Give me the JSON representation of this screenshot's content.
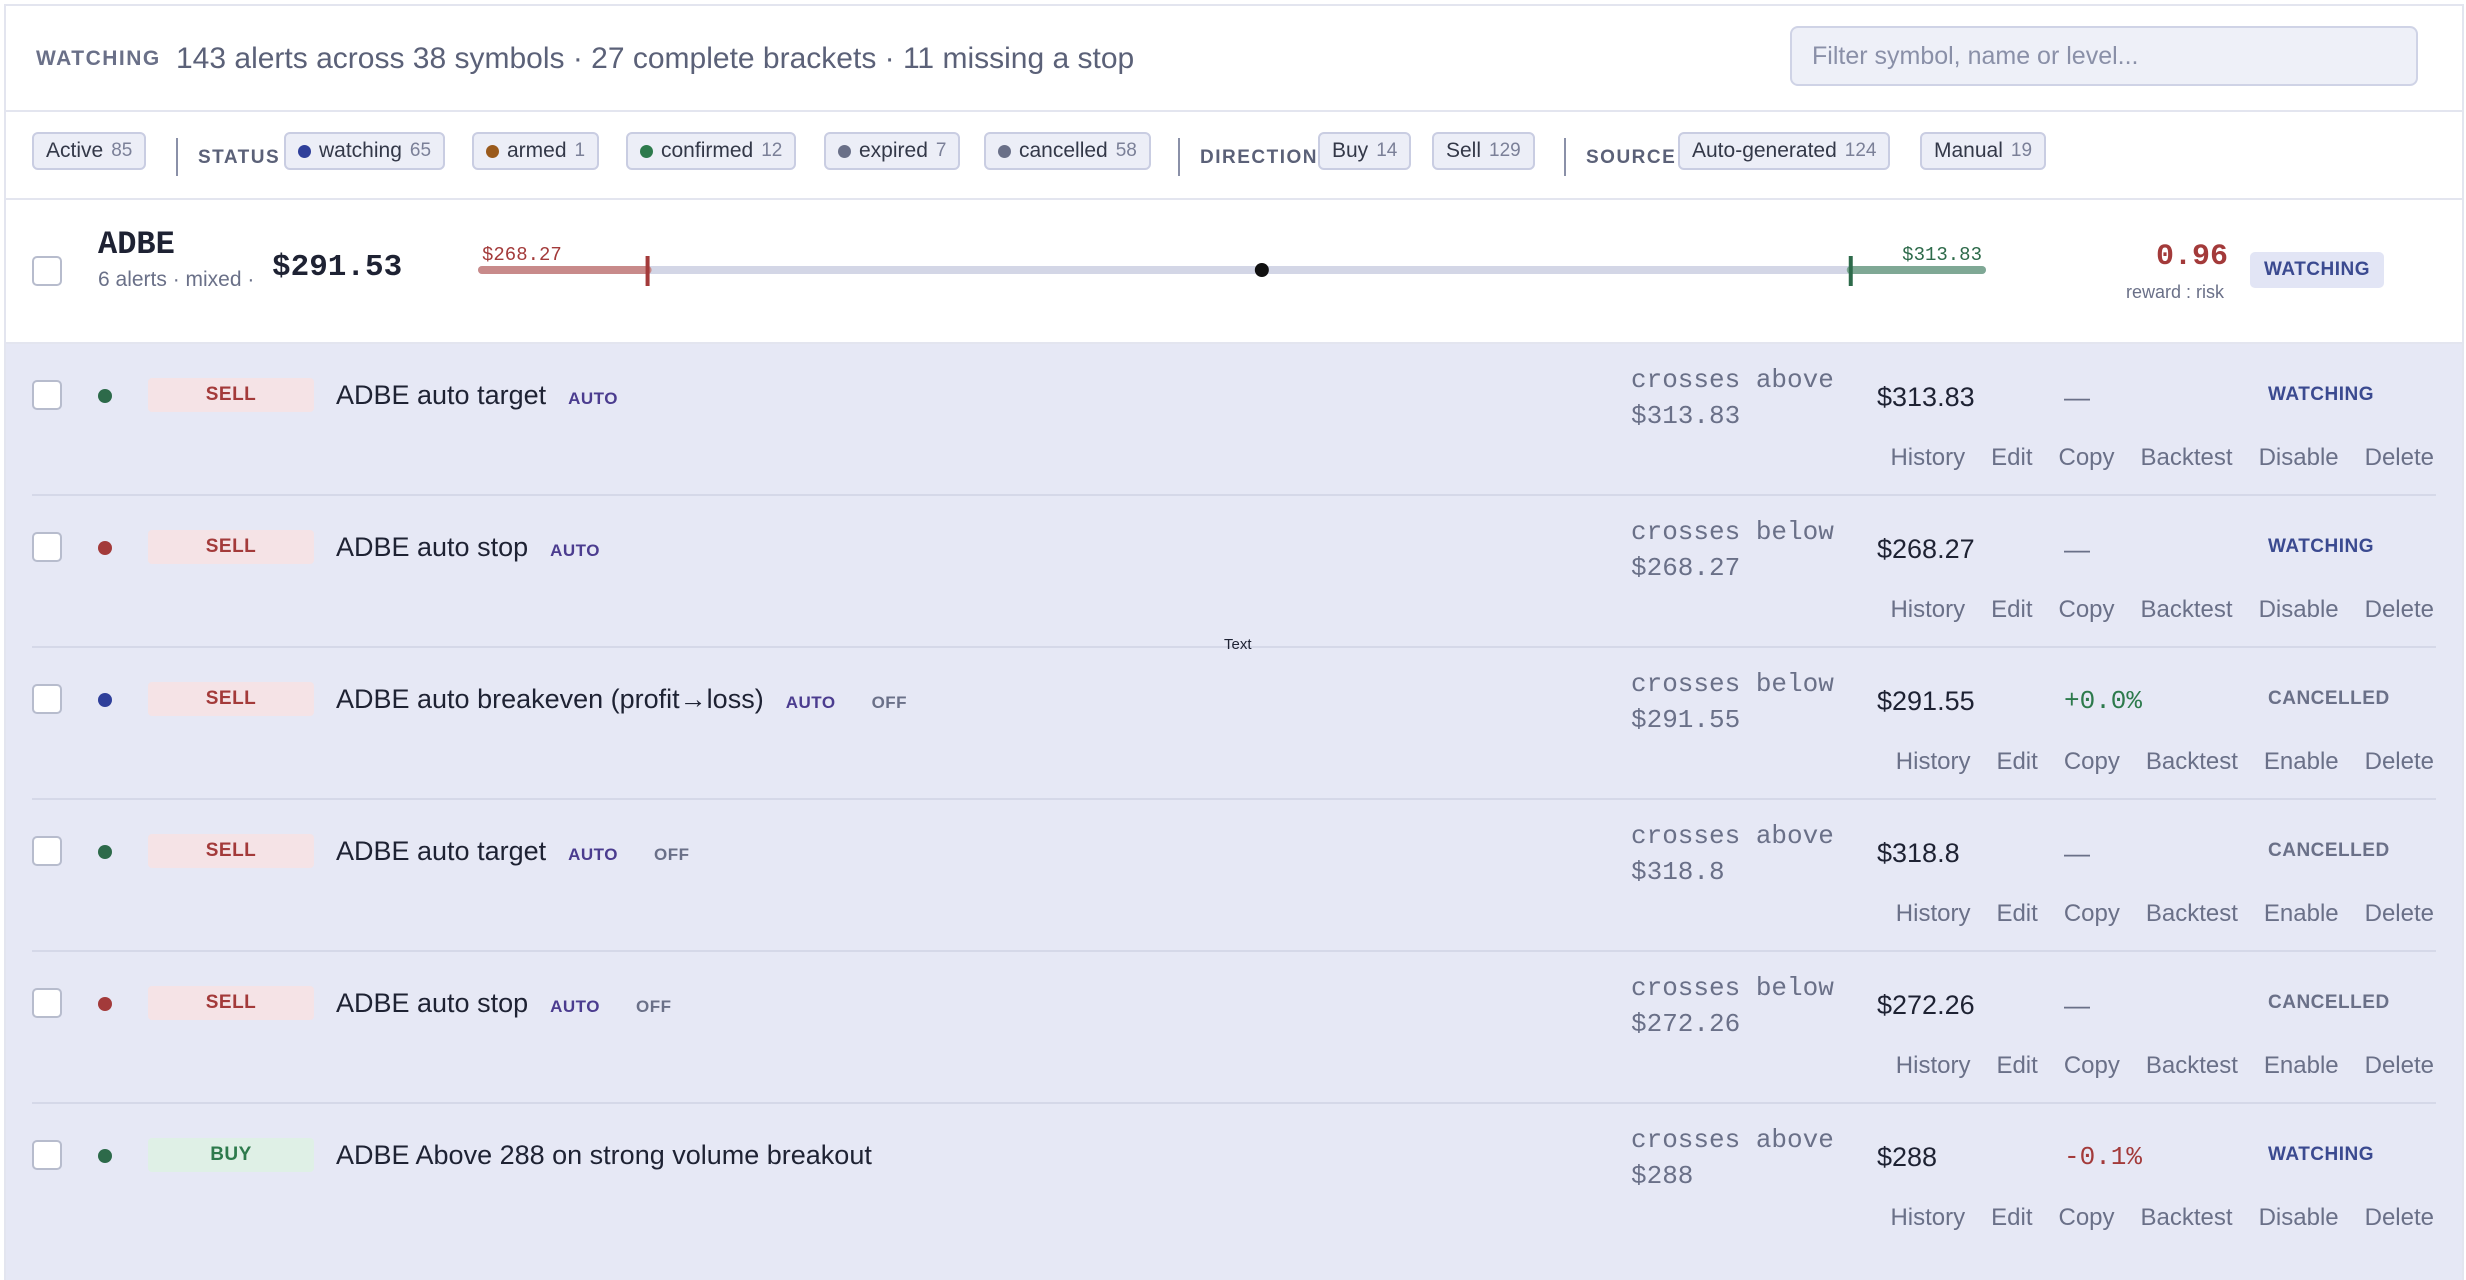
{
  "header": {
    "kicker": "WATCHING",
    "summary": "143 alerts across 38 symbols · 27 complete brackets · 11 missing a stop",
    "search_placeholder": "Filter symbol, name or level..."
  },
  "filters": {
    "active": {
      "label": "Active",
      "count": "85"
    },
    "status_label": "STATUS",
    "status": [
      {
        "label": "watching",
        "count": "65",
        "color": "#2f3f9a"
      },
      {
        "label": "armed",
        "count": "1",
        "color": "#9a5a1c"
      },
      {
        "label": "confirmed",
        "count": "12",
        "color": "#2d7a4c"
      },
      {
        "label": "expired",
        "count": "7",
        "color": "#6a7088"
      },
      {
        "label": "cancelled",
        "count": "58",
        "color": "#6a7088"
      }
    ],
    "direction_label": "DIRECTION",
    "direction": [
      {
        "label": "Buy",
        "count": "14"
      },
      {
        "label": "Sell",
        "count": "129"
      }
    ],
    "source_label": "SOURCE",
    "source": [
      {
        "label": "Auto-generated",
        "count": "124"
      },
      {
        "label": "Manual",
        "count": "19"
      }
    ]
  },
  "group": {
    "symbol": "ADBE",
    "subtitle": "6 alerts · mixed ·",
    "price": "$291.53",
    "stop_label": "$268.27",
    "target_label": "$313.83",
    "rr_value": "0.96",
    "rr_label": "reward : risk",
    "status": "WATCHING",
    "bracket": {
      "min": 262,
      "max": 318.8,
      "stop": 268.27,
      "entry": 291.53,
      "target": 313.83
    }
  },
  "floating_text": "Text",
  "rows": [
    {
      "side": "SELL",
      "name": "ADBE auto target",
      "auto": "AUTO",
      "off": "",
      "cond1": "crosses above",
      "cond2": "$313.83",
      "level": "$313.83",
      "change": "—",
      "change_kind": "dash",
      "status": "WATCHING",
      "status_kind": "watching",
      "dot": "#2d6a4a",
      "actions": [
        "History",
        "Edit",
        "Copy",
        "Backtest",
        "Disable",
        "Delete"
      ]
    },
    {
      "side": "SELL",
      "name": "ADBE auto stop",
      "auto": "AUTO",
      "off": "",
      "cond1": "crosses below",
      "cond2": "$268.27",
      "level": "$268.27",
      "change": "—",
      "change_kind": "dash",
      "status": "WATCHING",
      "status_kind": "watching",
      "dot": "#a33a3a",
      "actions": [
        "History",
        "Edit",
        "Copy",
        "Backtest",
        "Disable",
        "Delete"
      ]
    },
    {
      "side": "SELL",
      "name": "ADBE auto breakeven (profit→loss)",
      "auto": "AUTO",
      "off": "OFF",
      "cond1": "crosses below",
      "cond2": "$291.55",
      "level": "$291.55",
      "change": "+0.0%",
      "change_kind": "pos",
      "status": "CANCELLED",
      "status_kind": "cancelled",
      "dot": "#2f3f9a",
      "actions": [
        "History",
        "Edit",
        "Copy",
        "Backtest",
        "Enable",
        "Delete"
      ]
    },
    {
      "side": "SELL",
      "name": "ADBE auto target",
      "auto": "AUTO",
      "off": "OFF",
      "cond1": "crosses above",
      "cond2": "$318.8",
      "level": "$318.8",
      "change": "—",
      "change_kind": "dash",
      "status": "CANCELLED",
      "status_kind": "cancelled",
      "dot": "#2d6a4a",
      "actions": [
        "History",
        "Edit",
        "Copy",
        "Backtest",
        "Enable",
        "Delete"
      ]
    },
    {
      "side": "SELL",
      "name": "ADBE auto stop",
      "auto": "AUTO",
      "off": "OFF",
      "cond1": "crosses below",
      "cond2": "$272.26",
      "level": "$272.26",
      "change": "—",
      "change_kind": "dash",
      "status": "CANCELLED",
      "status_kind": "cancelled",
      "dot": "#a33a3a",
      "actions": [
        "History",
        "Edit",
        "Copy",
        "Backtest",
        "Enable",
        "Delete"
      ]
    },
    {
      "side": "BUY",
      "name": "ADBE Above 288 on strong volume breakout",
      "auto": "",
      "off": "",
      "cond1": "crosses above",
      "cond2": "$288",
      "level": "$288",
      "change": "-0.1%",
      "change_kind": "neg",
      "status": "WATCHING",
      "status_kind": "watching",
      "dot": "#2d6a4a",
      "actions": [
        "History",
        "Edit",
        "Copy",
        "Backtest",
        "Disable",
        "Delete"
      ]
    }
  ]
}
